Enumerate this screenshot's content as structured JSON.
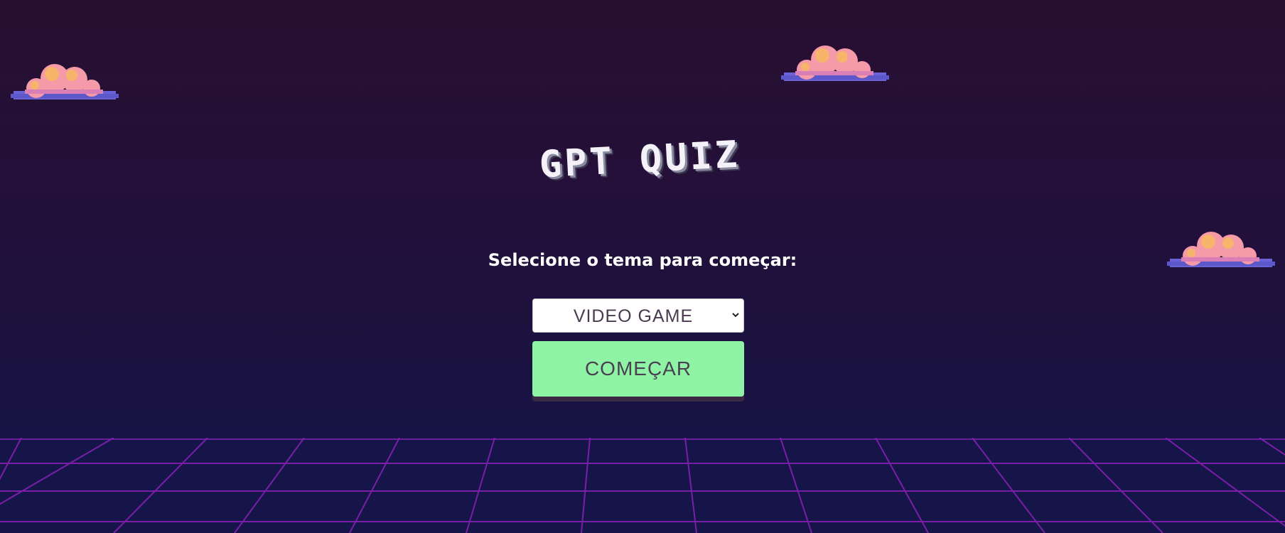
{
  "app": {
    "title": "GPT QUIZ"
  },
  "main": {
    "prompt": "Selecione o tema para começar:",
    "theme_select": {
      "selected": "VIDEO GAME"
    },
    "start_button": {
      "label": "COMEÇAR"
    }
  },
  "icons": {
    "clouds": [
      "cloud-icon",
      "cloud-icon",
      "cloud-icon"
    ],
    "select_arrow": "chevron-down-icon"
  },
  "colors": {
    "background_top": "#270f30",
    "background_bottom": "#14154a",
    "grid_lines": "#7a1ea8",
    "button": "#8ff3a6",
    "cloud_pink": "#f59aa8",
    "cloud_orange": "#f7b56b",
    "cloud_blue": "#6a63d8"
  }
}
